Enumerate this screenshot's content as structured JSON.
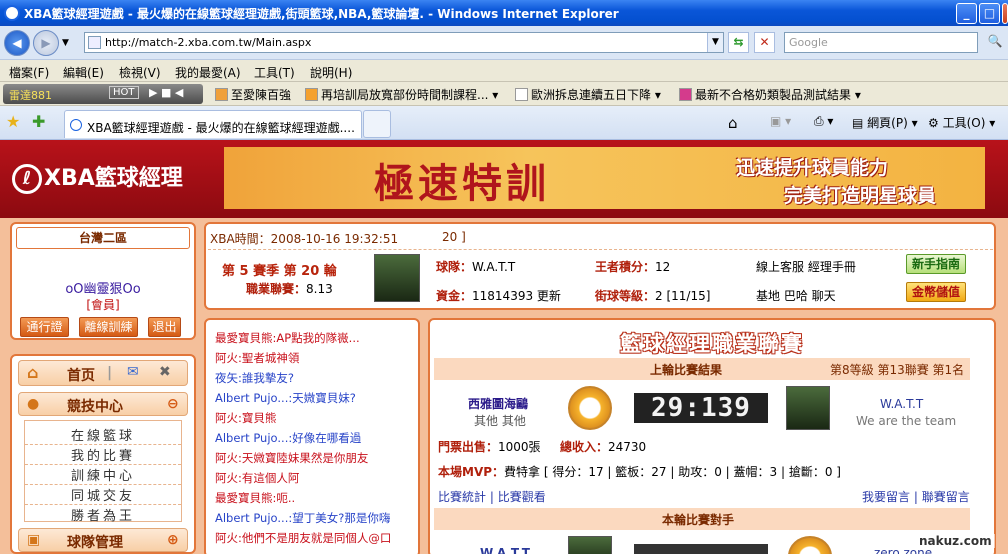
{
  "window": {
    "title": "XBA籃球經理遊戲 - 最火爆的在線籃球經理遊戲,街頭籃球,NBA,籃球論壇. - Windows Internet Explorer",
    "min": "_",
    "max": "□",
    "close": "✕"
  },
  "address": {
    "url": "http://match-2.xba.com.tw/Main.aspx",
    "search_placeholder": "Google"
  },
  "menu": [
    "檔案(F)",
    "編輯(E)",
    "檢視(V)",
    "我的最愛(A)",
    "工具(T)",
    "說明(H)"
  ],
  "links": {
    "radio_label": "雷達881",
    "radio_hot": "HOT",
    "items": [
      "至愛陳百強",
      "再培訓局放寬部份時間制課程...",
      "歐洲拆息連續五日下降",
      "最新不合格奶類製品測試結果"
    ]
  },
  "tabs": {
    "active": "XBA籃球經理遊戲 - 最火爆的在線籃球經理遊戲....",
    "page_menu": "網頁(P)",
    "tools_menu": "工具(O)"
  },
  "site": {
    "logo_text": "XBA籃球經理",
    "banner_title": "極速特訓",
    "banner_line1": "迅速提升球員能力",
    "banner_line2": "完美打造明星球員"
  },
  "user": {
    "region": "台灣二區",
    "name": "oO幽靈狠Oo",
    "role": "[會員]",
    "btn_pass": "通行證",
    "btn_leave": "離線訓練",
    "btn_exit": "退出"
  },
  "nav": {
    "home": "首页",
    "compete_header": "競技中心",
    "compete_items": [
      "在線籃球",
      "我的比賽",
      "訓練中心",
      "同城交友",
      "勝者為王"
    ],
    "team_header": "球隊管理"
  },
  "status": {
    "xba_time_label": "XBA時間：",
    "xba_time": "2008-10-16 19:32:51",
    "ticker": "20 ]",
    "season": "第 5 賽季 第 20 輪",
    "league_label": "職業聯賽：",
    "league_val": "8.13",
    "team_label": "球隊：",
    "team_val": "W.A.T.T",
    "king_label": "王者積分：",
    "king_val": "12",
    "cash_label": "資金：",
    "cash_val": "11814393",
    "update": "更新",
    "street_label": "街球等級：",
    "street_val": "2 [11/15]",
    "links1": "線上客服  經理手冊",
    "links2": "基地  巴哈  聊天",
    "btn_newbie": "新手指南",
    "btn_gold": "金幣儲值"
  },
  "chat": [
    {
      "name": "最愛寶貝熊",
      "text": ":AP點我的隊嶶...",
      "c": "n1"
    },
    {
      "name": "阿火",
      "text": ":聖者城神領",
      "c": "n1"
    },
    {
      "name": "夜矢",
      "text": ":誰我摯友?",
      "c": "n2"
    },
    {
      "name": "Albert Pujo...",
      "text": ":天媺寶貝妹?",
      "c": "n2"
    },
    {
      "name": "阿火",
      "text": ":寶貝熊",
      "c": "n1"
    },
    {
      "name": "Albert Pujo...",
      "text": ":好像在哪看過",
      "c": "n2"
    },
    {
      "name": "阿火",
      "text": ":天媺寶陸妹果然是你朋友",
      "c": "n1"
    },
    {
      "name": "阿火",
      "text": ":有這個人阿",
      "c": "n1"
    },
    {
      "name": "最愛寶貝熊",
      "text": ":呃..",
      "c": "n1"
    },
    {
      "name": "Albert Pujo...",
      "text": ":望丁美女?那是你嗨",
      "c": "n2"
    },
    {
      "name": "阿火",
      "text": ":他們不是朋友就是同個人@口",
      "c": "n1"
    }
  ],
  "league": {
    "title": "籃球經理職業聯賽",
    "last_result_label": "上輪比賽結果",
    "rank_info": "第8等級  第13聯賽  第1名",
    "home_team": "西雅圖海鷗",
    "home_sub": "其他  其他",
    "score": "29:139",
    "away_team": "W.A.T.T",
    "away_sub": "We are the team",
    "ticket_label": "門票出售：",
    "ticket_val": "1000張",
    "income_label": "總收入：",
    "income_val": "24730",
    "mvp_label": "本場MVP：",
    "mvp_val": "費特拿 [ 得分：17 | 籃板：27 | 助攻：0 | 蓋帽：3 | 搶斷：0 ]",
    "stats_link": "比賽統計",
    "watch_link": "比賽觀看",
    "comment_link": "我要留言",
    "league_comment": "聯賽留言",
    "next_label": "本輪比賽對手",
    "next_home": "W.A.T.T",
    "next_away": "zero zone"
  },
  "watermark": "nakuz.com"
}
